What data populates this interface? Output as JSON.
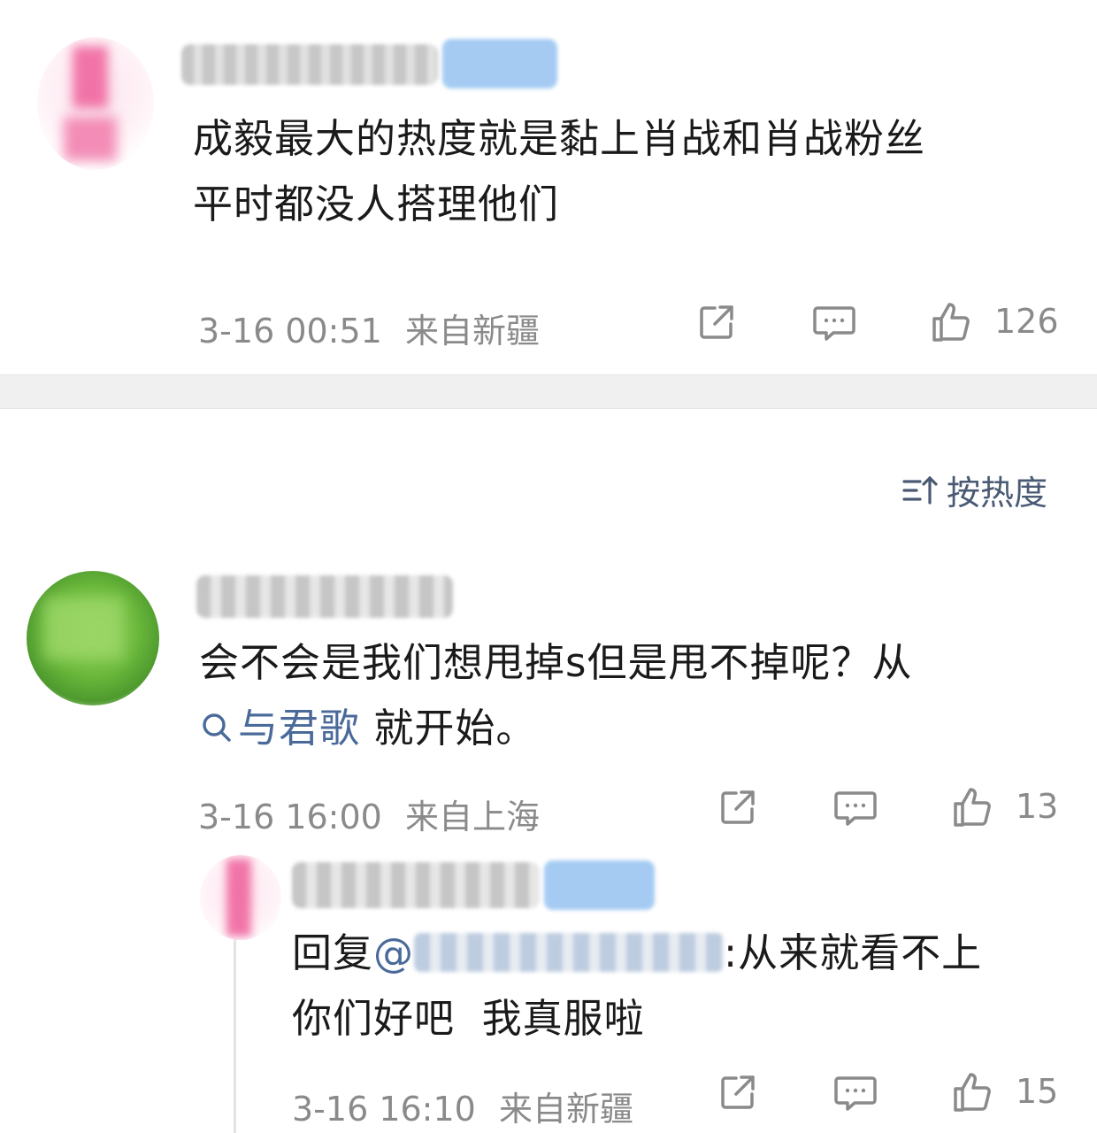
{
  "comments": [
    {
      "text_line1": "成毅最大的热度就是黏上肖战和肖战粉丝",
      "text_line2": "平时都没人搭理他们",
      "time": "3-16 00:51",
      "location": "来自新疆",
      "likes": "126"
    },
    {
      "text_line1": "会不会是我们想甩掉s但是甩不掉呢？从",
      "topic": "与君歌",
      "text_line2_rest": " 就开始。",
      "time": "3-16 16:00",
      "location": "来自上海",
      "likes": "13"
    }
  ],
  "reply": {
    "prefix": "回复",
    "at_symbol": "@",
    "colon_text": ":从来就看不上",
    "text_line2": "你们好吧  我真服啦",
    "time": "3-16 16:10",
    "location": "来自新疆",
    "likes": "15"
  },
  "sort": {
    "label": "按热度"
  },
  "icons": {
    "share": "share-icon",
    "comment": "comment-icon",
    "like": "thumbs-up-icon",
    "sort": "sort-icon",
    "topic_search": "search-icon"
  },
  "colors": {
    "link": "#4a6a9a",
    "meta": "#8a8a8a",
    "divider": "#f0f0f0"
  }
}
